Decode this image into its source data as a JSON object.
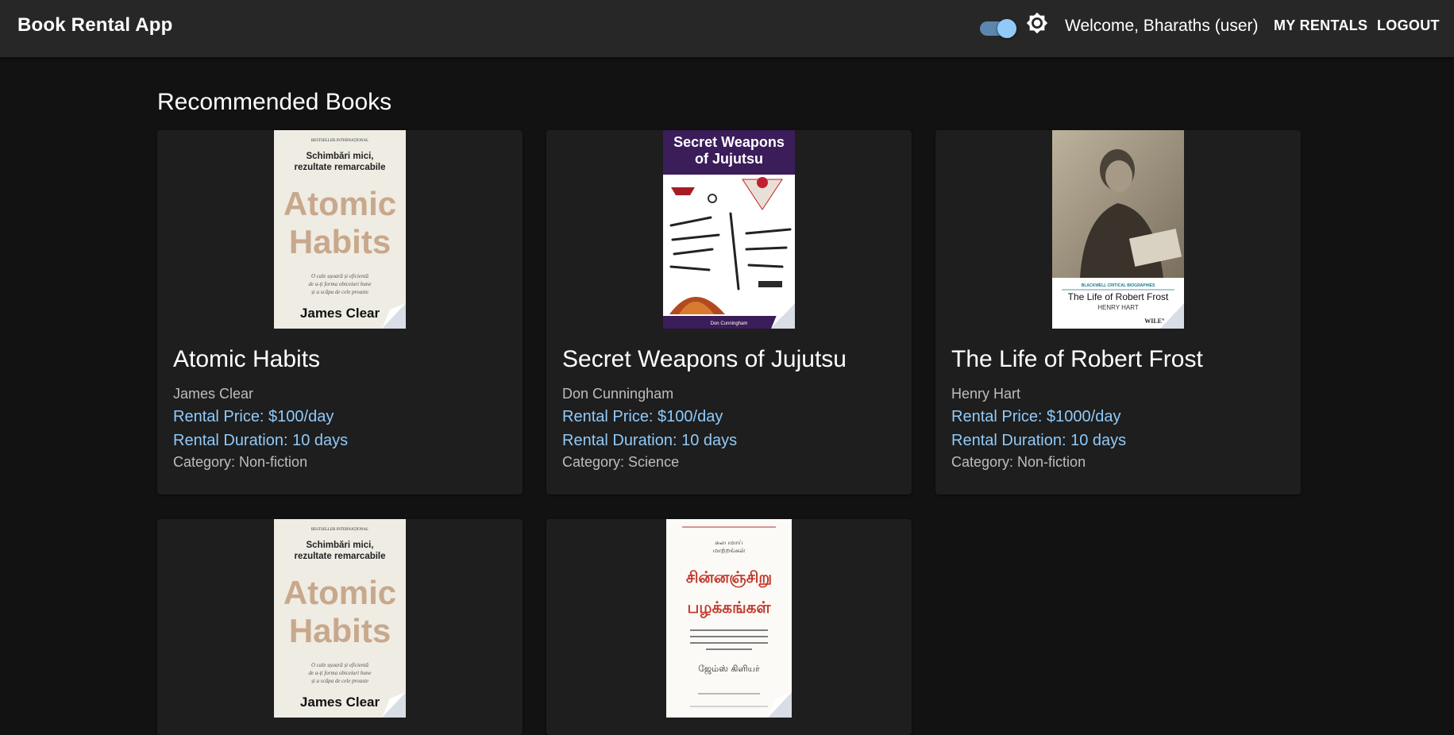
{
  "header": {
    "title": "Book Rental App",
    "welcome": "Welcome, Bharaths (user)",
    "my_rentals": "MY RENTALS",
    "logout": "LOGOUT",
    "theme_toggle_on": true,
    "theme_icon": "brightness-icon"
  },
  "section": {
    "title": "Recommended Books"
  },
  "books": [
    {
      "title": "Atomic Habits",
      "author": "James Clear",
      "price": "Rental Price: $100/day",
      "duration": "Rental Duration: 10 days",
      "category": "Category: Non-fiction",
      "cover": {
        "top": "BESTSELLER INTERNAȚIONAL",
        "sub1": "Schimbări mici,",
        "sub2": "rezultate remarcabile",
        "big1": "Atomic",
        "big2": "Habits",
        "desc1": "O cale ușoară și eficientă",
        "desc2": "de a-ți forma obiceiuri bune",
        "desc3": "și a scăpa de cele proaste",
        "author": "James Clear"
      }
    },
    {
      "title": "Secret Weapons of Jujutsu",
      "author": "Don Cunningham",
      "price": "Rental Price: $100/day",
      "duration": "Rental Duration: 10 days",
      "category": "Category: Science",
      "cover": {
        "line1": "Secret Weapons",
        "line2": "of Jujutsu",
        "author": "Don Cunningham"
      }
    },
    {
      "title": "The Life of Robert Frost",
      "author": "Henry Hart",
      "price": "Rental Price: $1000/day",
      "duration": "Rental Duration: 10 days",
      "category": "Category: Non-fiction",
      "cover": {
        "series": "BLACKWELL CRITICAL BIOGRAPHIES",
        "title": "The Life of Robert Frost",
        "author": "HENRY HART",
        "publisher": "WILEY"
      }
    },
    {
      "cover": {
        "top": "BESTSELLER INTERNAȚIONAL",
        "sub1": "Schimbări mici,",
        "sub2": "rezultate remarcabile",
        "big1": "Atomic",
        "big2": "Habits",
        "desc1": "O cale ușoară și eficientă",
        "desc2": "de a-ți forma obiceiuri bune",
        "desc3": "și a scăpa de cele proaste",
        "author": "James Clear"
      }
    },
    {
      "cover": {
        "sub1": "சுலபமாய்",
        "sub2": "மாற்றங்கள்",
        "big1": "சின்னஞ்சிறு",
        "big2": "பழக்கங்கள்",
        "author": "ஜேம்ஸ் கிளியர்"
      }
    }
  ],
  "colors": {
    "background": "#121212",
    "appbar": "#272727",
    "card": "#1e1e1e",
    "accent": "#90caf9"
  }
}
